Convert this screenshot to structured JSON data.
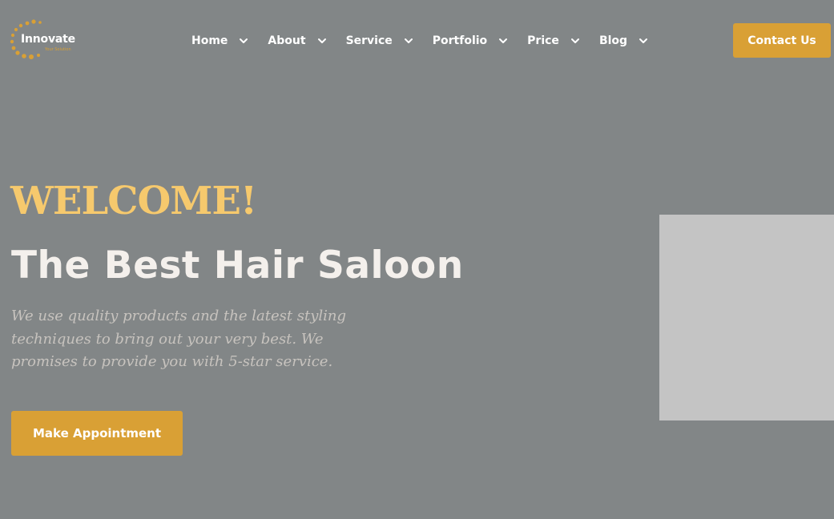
{
  "header": {
    "logo": {
      "name": "Innovate",
      "tagline": "Your Solution"
    },
    "nav": [
      {
        "label": "Home",
        "icon": "chevron-down-icon"
      },
      {
        "label": "About",
        "icon": "chevron-down-icon"
      },
      {
        "label": "Service",
        "icon": "chevron-down-icon"
      },
      {
        "label": "Portfolio",
        "icon": "chevron-down-icon"
      },
      {
        "label": "Price",
        "icon": "chevron-down-icon"
      },
      {
        "label": "Blog",
        "icon": "chevron-down-icon"
      }
    ],
    "contact_label": "Contact Us"
  },
  "hero": {
    "welcome": "WELCOME!",
    "headline": "The Best Hair Saloon",
    "description": "We use quality products and the latest styling techniques to bring out your very best. We promises to provide you with 5-star service.",
    "cta_label": "Make Appointment"
  },
  "colors": {
    "background": "#828687",
    "accent": "#d9a035",
    "welcome": "#f6c96d",
    "headline": "#f4f0ec",
    "image_placeholder": "#c4c4c4"
  }
}
